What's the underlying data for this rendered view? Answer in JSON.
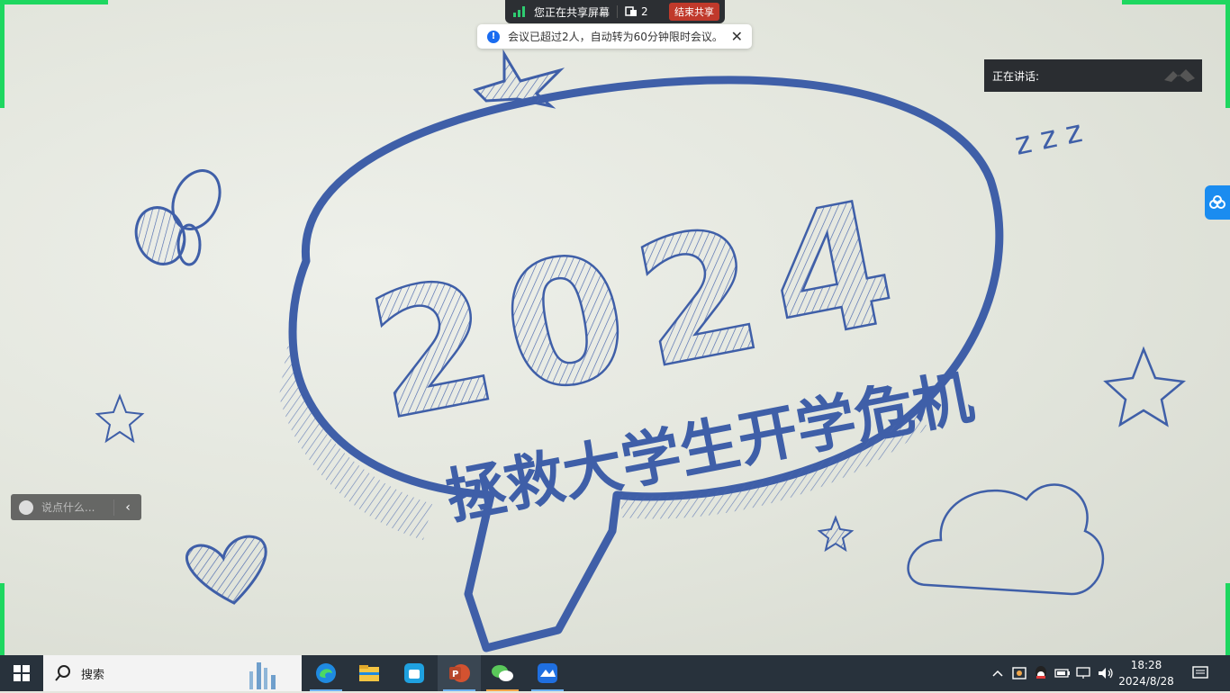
{
  "share_bar": {
    "status_text": "您正在共享屏幕",
    "participant_count": "2",
    "end_share_label": "结束共享"
  },
  "notice": {
    "message": "会议已超过2人，自动转为60分钟限时会议。"
  },
  "speaking_panel": {
    "label": "正在讲话:"
  },
  "slide": {
    "year": "2024",
    "title": "拯救大学生开学危机"
  },
  "comment_box": {
    "placeholder": "说点什么..."
  },
  "taskbar": {
    "search_label": "搜索",
    "apps": [
      "edge-icon",
      "file-explorer-icon",
      "store-icon",
      "powerpoint-icon",
      "wechat-icon",
      "tencent-meeting-icon"
    ],
    "tray_icons": [
      "chevron-up-icon",
      "security-icon",
      "qq-icon",
      "battery-icon",
      "network-icon",
      "volume-icon"
    ],
    "time": "18:28",
    "date": "2024/8/28"
  },
  "colors": {
    "share_green": "#1ed760",
    "slide_blue": "#3f5fa8",
    "end_red": "#c0392b",
    "accent_blue": "#1a8cf0"
  }
}
